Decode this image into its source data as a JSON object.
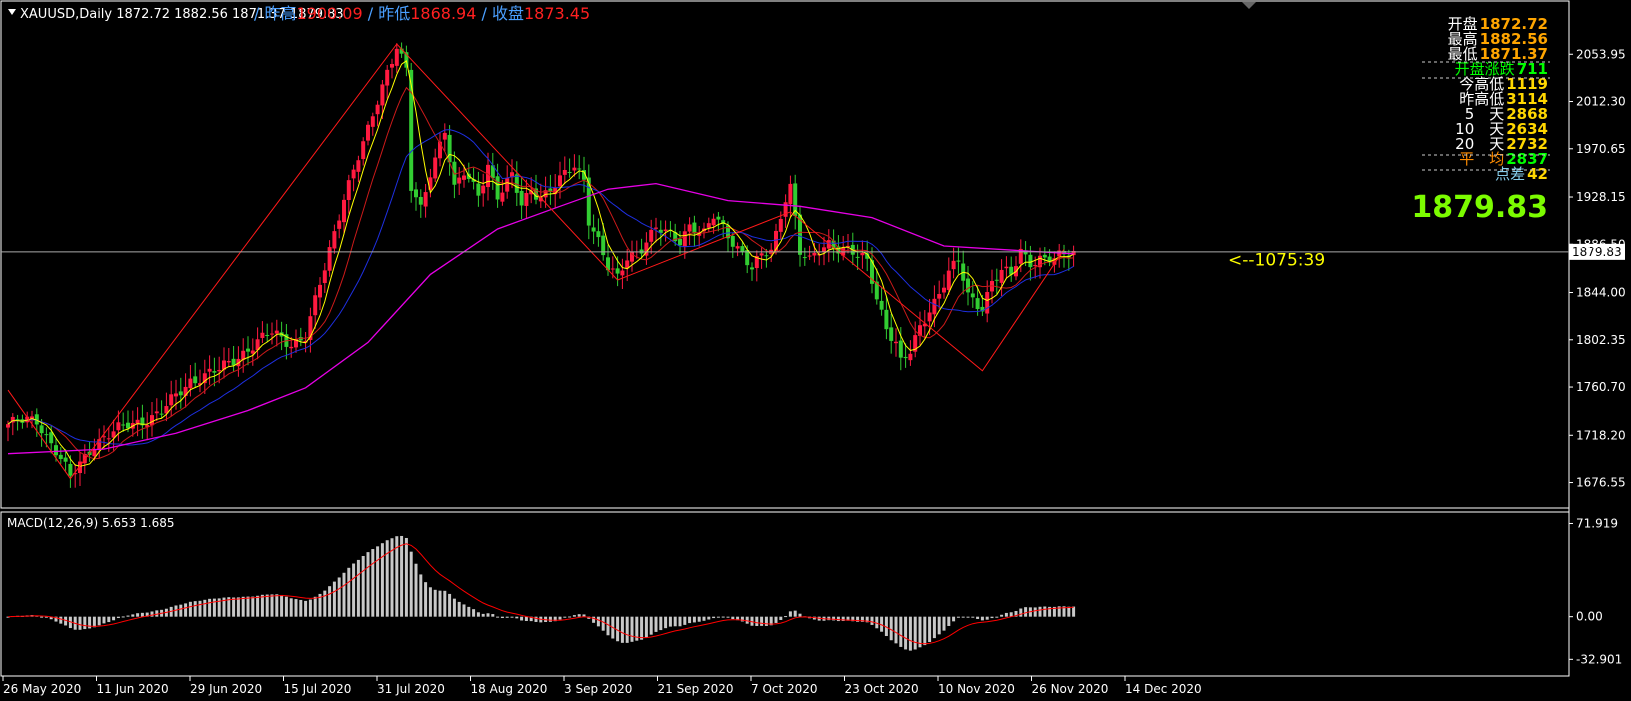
{
  "header": {
    "symbol_line": "XAUUSD,Daily  1872.72 1882.56 1871.37 1879.83",
    "prev_high_label": "/ 昨高",
    "prev_high_value": "1900.09",
    "prev_low_label": " / 昨低",
    "prev_low_value": "1868.94",
    "prev_close_label": " / 收盘",
    "prev_close_value": "1873.45"
  },
  "info_panel": {
    "rows": [
      {
        "label": "开盘",
        "value": "1872.72",
        "label_color": "#ffffff",
        "value_color": "#ffa500"
      },
      {
        "label": "最高",
        "value": "1882.56",
        "label_color": "#ffffff",
        "value_color": "#ffa500"
      },
      {
        "label": "最低",
        "value": "1871.37",
        "label_color": "#ffffff",
        "value_color": "#ffa500"
      },
      {
        "label": "开盘涨跌",
        "value": "711",
        "label_color": "#00ff00",
        "value_color": "#00ff00"
      },
      {
        "label": "今高低",
        "value": "1119",
        "label_color": "#ffffff",
        "value_color": "#ffd700"
      },
      {
        "label": "昨高低",
        "value": "3114",
        "label_color": "#ffffff",
        "value_color": "#ffd700"
      },
      {
        "label": "5　天",
        "value": "2868",
        "label_color": "#ffffff",
        "value_color": "#ffd700"
      },
      {
        "label": "10　天",
        "value": "2634",
        "label_color": "#ffffff",
        "value_color": "#ffd700"
      },
      {
        "label": "20　天",
        "value": "2732",
        "label_color": "#ffffff",
        "value_color": "#ffd700"
      },
      {
        "label": "平　均",
        "value": "2837",
        "label_color": "#ff8c00",
        "value_color": "#00ff00"
      },
      {
        "label": "点差",
        "value": "42",
        "label_color": "#87ceeb",
        "value_color": "#ffd700"
      }
    ],
    "big_price": "1879.83",
    "big_price_color": "#7cfc00"
  },
  "timer_label": "<--1075:39",
  "current_price_tag": "1879.83",
  "price_axis": [
    "2053.95",
    "2012.30",
    "1970.65",
    "1928.15",
    "1886.50",
    "1844.00",
    "1802.35",
    "1760.70",
    "1718.20",
    "1676.55"
  ],
  "macd": {
    "title": "MACD(12,26,9) 5.653 1.685",
    "axis": [
      "71.919",
      "0.00",
      "-32.901"
    ]
  },
  "date_axis": [
    "26 May 2020",
    "11 Jun 2020",
    "29 Jun 2020",
    "15 Jul 2020",
    "31 Jul 2020",
    "18 Aug 2020",
    "3 Sep 2020",
    "21 Sep 2020",
    "7 Oct 2020",
    "23 Oct 2020",
    "10 Nov 2020",
    "26 Nov 2020",
    "14 Dec 2020"
  ],
  "colors": {
    "bull": "#ff1a40",
    "bear": "#32cd32",
    "ma_fast": "#ffff00",
    "ma_mid": "#cc1a1a",
    "ma_slow": "#1e2fe0",
    "ma_long": "#e600e6",
    "zigzag": "#ff1a1a",
    "macd_hist": "#c8c8c8",
    "macd_signal": "#ff0000",
    "grid": "#ffffff"
  },
  "chart_data": {
    "type": "candlestick",
    "symbol": "XAUUSD",
    "timeframe": "Daily",
    "price_range": [
      1655,
      2100
    ],
    "macd_range": [
      -45,
      80
    ],
    "anchors": [
      [
        0,
        1728
      ],
      [
        6,
        1732
      ],
      [
        10,
        1705
      ],
      [
        13,
        1680
      ],
      [
        18,
        1712
      ],
      [
        25,
        1727
      ],
      [
        32,
        1738
      ],
      [
        38,
        1767
      ],
      [
        44,
        1775
      ],
      [
        50,
        1795
      ],
      [
        55,
        1808
      ],
      [
        59,
        1800
      ],
      [
        62,
        1805
      ],
      [
        66,
        1865
      ],
      [
        70,
        1930
      ],
      [
        75,
        1985
      ],
      [
        79,
        2040
      ],
      [
        81,
        2063
      ],
      [
        83,
        2040
      ],
      [
        84,
        1935
      ],
      [
        86,
        1915
      ],
      [
        88,
        1950
      ],
      [
        91,
        1990
      ],
      [
        93,
        1935
      ],
      [
        95,
        1948
      ],
      [
        98,
        1930
      ],
      [
        100,
        1958
      ],
      [
        102,
        1930
      ],
      [
        105,
        1945
      ],
      [
        107,
        1920
      ],
      [
        109,
        1935
      ],
      [
        111,
        1930
      ],
      [
        113,
        1935
      ],
      [
        115,
        1942
      ],
      [
        118,
        1955
      ],
      [
        120,
        1945
      ],
      [
        121,
        1910
      ],
      [
        123,
        1890
      ],
      [
        125,
        1865
      ],
      [
        127,
        1855
      ],
      [
        129,
        1875
      ],
      [
        132,
        1885
      ],
      [
        135,
        1900
      ],
      [
        137,
        1895
      ],
      [
        140,
        1890
      ],
      [
        142,
        1905
      ],
      [
        145,
        1895
      ],
      [
        147,
        1910
      ],
      [
        150,
        1895
      ],
      [
        153,
        1880
      ],
      [
        155,
        1865
      ],
      [
        157,
        1875
      ],
      [
        159,
        1880
      ],
      [
        160,
        1895
      ],
      [
        162,
        1930
      ],
      [
        163,
        1940
      ],
      [
        165,
        1880
      ],
      [
        167,
        1870
      ],
      [
        169,
        1880
      ],
      [
        171,
        1888
      ],
      [
        173,
        1885
      ],
      [
        175,
        1882
      ],
      [
        177,
        1875
      ],
      [
        179,
        1870
      ],
      [
        181,
        1840
      ],
      [
        183,
        1815
      ],
      [
        185,
        1800
      ],
      [
        186,
        1782
      ],
      [
        188,
        1790
      ],
      [
        190,
        1812
      ],
      [
        192,
        1830
      ],
      [
        194,
        1845
      ],
      [
        196,
        1862
      ],
      [
        198,
        1870
      ],
      [
        200,
        1840
      ],
      [
        203,
        1832
      ],
      [
        205,
        1855
      ],
      [
        207,
        1862
      ],
      [
        209,
        1858
      ],
      [
        211,
        1880
      ],
      [
        213,
        1872
      ],
      [
        215,
        1875
      ],
      [
        218,
        1872
      ],
      [
        222,
        1880
      ]
    ],
    "ma_long_path": [
      [
        0,
        1702
      ],
      [
        20,
        1706
      ],
      [
        35,
        1720
      ],
      [
        50,
        1740
      ],
      [
        62,
        1760
      ],
      [
        75,
        1800
      ],
      [
        88,
        1860
      ],
      [
        102,
        1900
      ],
      [
        115,
        1920
      ],
      [
        125,
        1935
      ],
      [
        135,
        1940
      ],
      [
        150,
        1925
      ],
      [
        165,
        1920
      ],
      [
        180,
        1910
      ],
      [
        195,
        1885
      ],
      [
        222,
        1878
      ]
    ],
    "zigzag": [
      [
        0,
        1758
      ],
      [
        13,
        1680
      ],
      [
        81,
        2063
      ],
      [
        127,
        1855
      ],
      [
        163,
        1915
      ],
      [
        203,
        1775
      ],
      [
        220,
        1882
      ]
    ],
    "macd_start": 20,
    "macd_peak": 70,
    "macd_trough": -30
  }
}
